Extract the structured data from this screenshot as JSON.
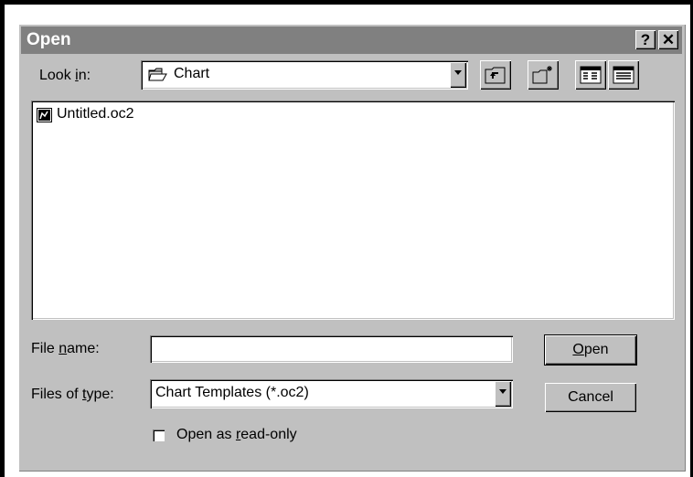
{
  "window": {
    "title": "Open",
    "help_glyph": "?",
    "close_glyph": "✕"
  },
  "look_in": {
    "label_pre": "Look ",
    "label_access": "i",
    "label_post": "n:",
    "value": "Chart",
    "folder_icon": "folder-icon"
  },
  "toolbar": {
    "up_folder_icon": "up-folder-icon",
    "new_folder_icon": "new-folder-icon",
    "list_view_icon": "list-view-icon",
    "details_view_icon": "details-view-icon"
  },
  "files": [
    {
      "name": "Untitled.oc2",
      "icon": "chart-file-icon"
    }
  ],
  "file_name": {
    "label_pre": "File ",
    "label_access": "n",
    "label_post": "ame:",
    "value": ""
  },
  "files_of_type": {
    "label_pre": "Files of ",
    "label_access": "t",
    "label_post": "ype:",
    "value": "Chart Templates (*.oc2)"
  },
  "read_only": {
    "label_pre": "Open as ",
    "label_access": "r",
    "label_post": "ead-only",
    "checked": false
  },
  "buttons": {
    "open_access": "O",
    "open_rest": "pen",
    "cancel": "Cancel"
  }
}
